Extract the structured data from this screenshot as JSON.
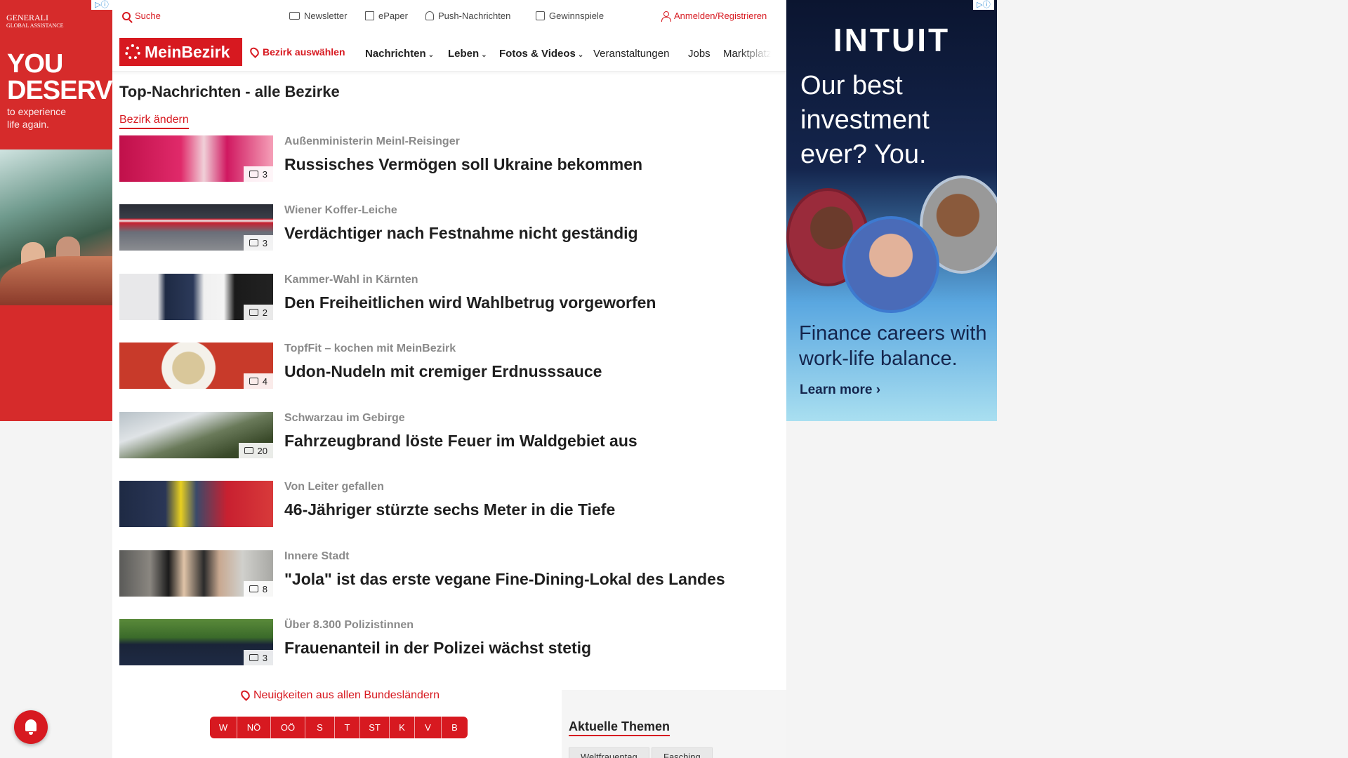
{
  "ads": {
    "left": {
      "brand": "GENERALI",
      "brand_sub": "GLOBAL ASSISTANCE",
      "headline_1": "YOU",
      "headline_2": "DESERVE",
      "sub_1": "to experience",
      "sub_2": "life again."
    },
    "right": {
      "logo": "INTUIT",
      "headline_1": "Our best",
      "headline_2": "investment",
      "headline_3": "ever? You.",
      "text_1": "Finance careers with",
      "text_2": "work-life balance.",
      "cta": "Learn more ›"
    },
    "badge": "▷ⓘ"
  },
  "topbar": {
    "search": "Suche",
    "newsletter": "Newsletter",
    "epaper": "ePaper",
    "push": "Push-Nachrichten",
    "games": "Gewinnspiele",
    "login": "Anmelden/Registrieren"
  },
  "nav": {
    "logo": "MeinBezirk",
    "district": "Bezirk auswählen",
    "items": [
      {
        "label": "Nachrichten",
        "has_menu": true
      },
      {
        "label": "Leben",
        "has_menu": true
      },
      {
        "label": "Fotos & Videos",
        "has_menu": true
      },
      {
        "label": "Veranstaltungen",
        "has_menu": false
      },
      {
        "label": "Jobs",
        "has_menu": false
      },
      {
        "label": "Marktplatz",
        "has_menu": false
      }
    ]
  },
  "section": {
    "title": "Top-Nachrichten - alle Bezirke",
    "change": "Bezirk ändern"
  },
  "articles": [
    {
      "kicker": "Außenministerin Meinl-Reisinger",
      "title": "Russisches Vermögen soll Ukraine bekommen",
      "count": "3"
    },
    {
      "kicker": "Wiener Koffer-Leiche",
      "title": "Verdächtiger nach Festnahme nicht geständig",
      "count": "3"
    },
    {
      "kicker": "Kammer-Wahl in Kärnten",
      "title": "Den Freiheitlichen wird Wahlbetrug vorgeworfen",
      "count": "2"
    },
    {
      "kicker": "TopfFit – kochen mit MeinBezirk",
      "title": "Udon-Nudeln mit cremiger Erdnusssauce",
      "count": "4"
    },
    {
      "kicker": "Schwarzau im Gebirge",
      "title": "Fahrzeugbrand löste Feuer im Waldgebiet aus",
      "count": "20"
    },
    {
      "kicker": "Von Leiter gefallen",
      "title": "46-Jähriger stürzte sechs Meter in die Tiefe",
      "count": ""
    },
    {
      "kicker": "Innere Stadt",
      "title": "\"Jola\" ist das erste vegane Fine-Dining-Lokal des Landes",
      "count": "8"
    },
    {
      "kicker": "Über 8.300 Polizistinnen",
      "title": "Frauenanteil in der Polizei wächst stetig",
      "count": "3"
    }
  ],
  "footer": {
    "all_states": "Neuigkeiten aus allen Bundesländern",
    "states": [
      "W",
      "NÖ",
      "OÖ",
      "S",
      "T",
      "ST",
      "K",
      "V",
      "B"
    ],
    "topics_title": "Aktuelle Themen",
    "tags": [
      "Weltfrauentag",
      "Fasching"
    ]
  },
  "colors": {
    "brand_red": "#d71920",
    "kicker_grey": "#8a8a8a"
  }
}
